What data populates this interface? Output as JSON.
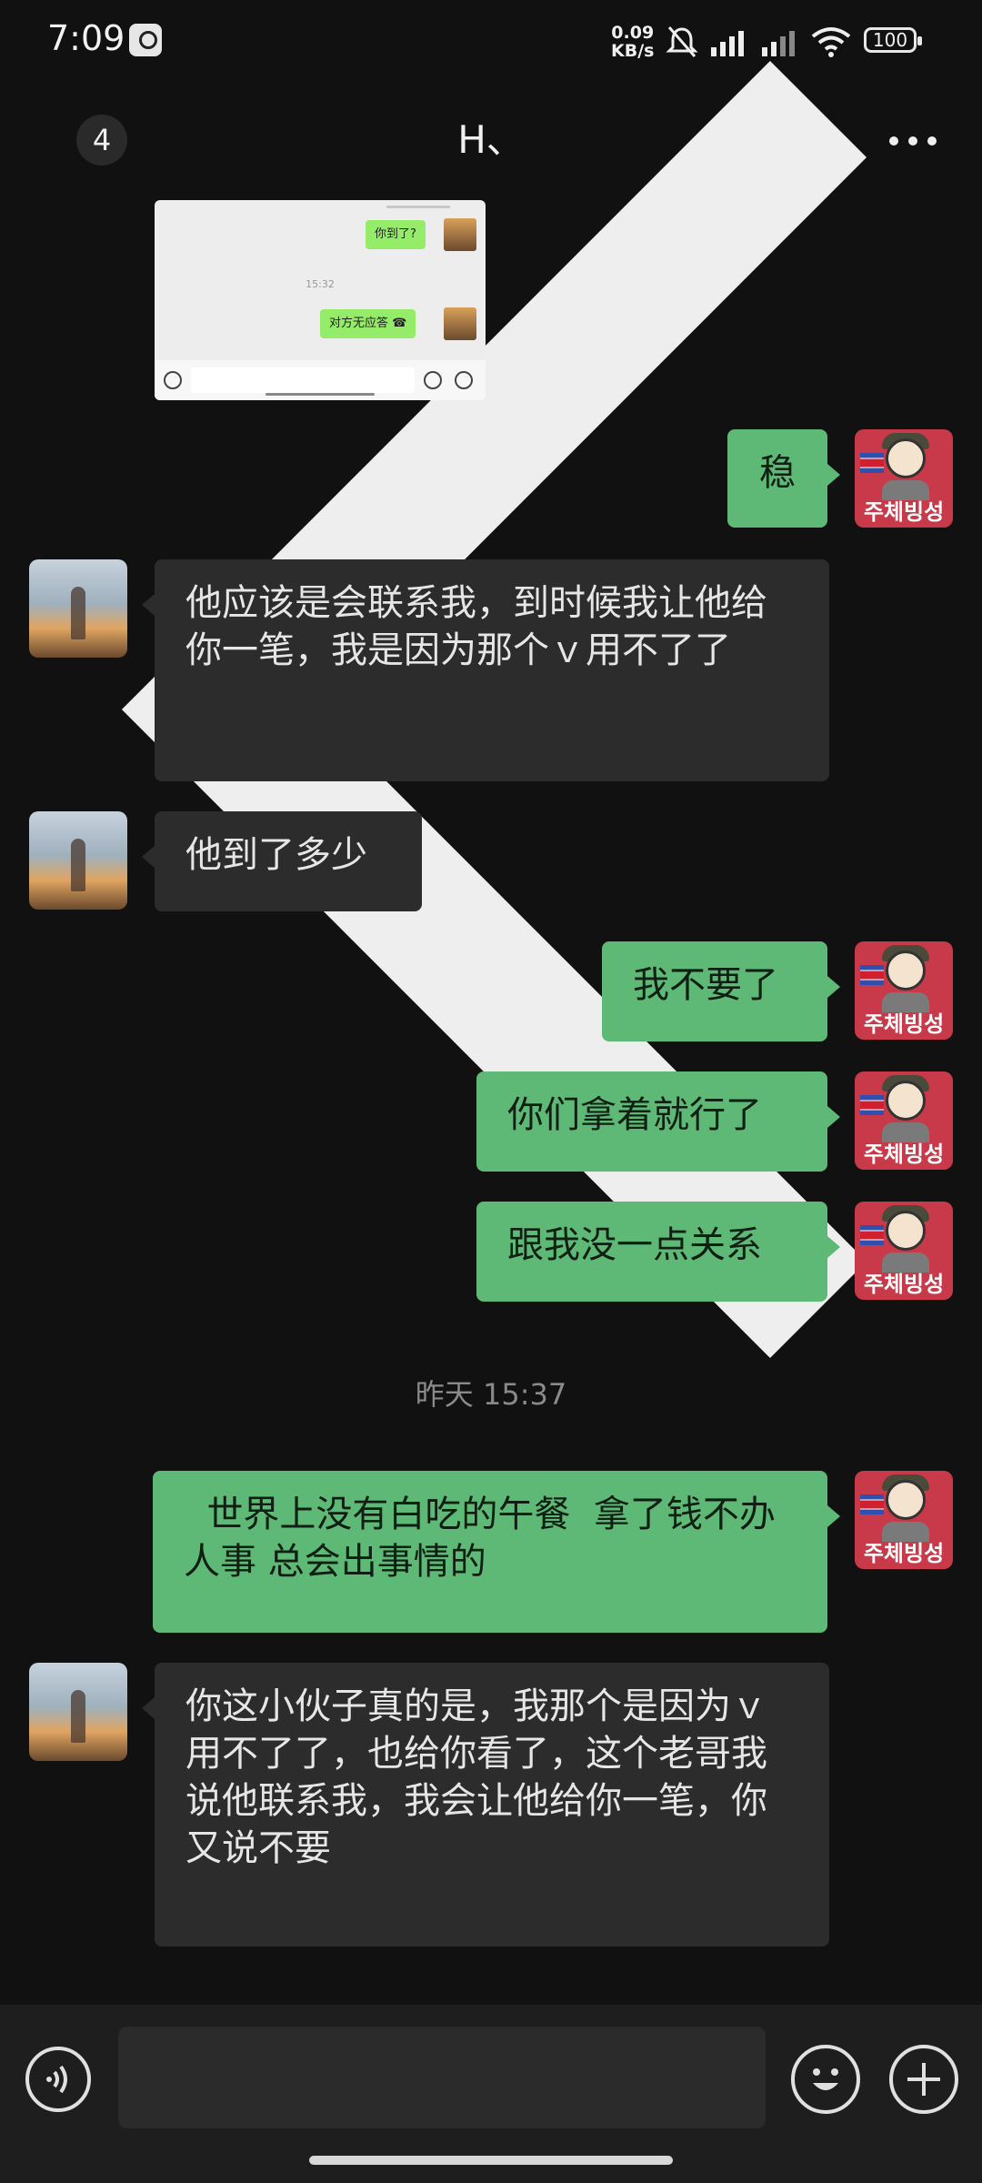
{
  "status_bar": {
    "time": "7:09",
    "net_speed_value": "0.09",
    "net_speed_unit": "KB/s",
    "battery": "100"
  },
  "header": {
    "unread_count": "4",
    "title": "H、"
  },
  "shared_screenshot": {
    "msg1": "你到了?",
    "time": "15:32",
    "msg2": "对方无应答"
  },
  "my_avatar_caption": "주체빙성",
  "messages": [
    {
      "side": "mine",
      "text": "稳"
    },
    {
      "side": "theirs",
      "text": "他应该是会联系我，到时候我让他给你一笔，我是因为那个ｖ用不了了"
    },
    {
      "side": "theirs",
      "text": "他到了多少"
    },
    {
      "side": "mine",
      "text": "我不要了"
    },
    {
      "side": "mine",
      "text": "你们拿着就行了"
    },
    {
      "side": "mine",
      "text": "跟我没一点关系"
    },
    {
      "side": "mine",
      "text": "  世界上没有白吃的午餐  拿了钱不办人事 总会出事情的"
    },
    {
      "side": "theirs",
      "text": "你这小伙子真的是，我那个是因为ｖ用不了了，也给你看了，这个老哥我说他联系我，我会让他给你一笔，你又说不要"
    }
  ],
  "timestamp": "昨天 15:37",
  "input": {
    "value": "",
    "placeholder": ""
  },
  "colors": {
    "background": "#111111",
    "my_bubble": "#5eb876",
    "their_bubble": "#2c2c2c",
    "avatar_red": "#c8394a"
  }
}
